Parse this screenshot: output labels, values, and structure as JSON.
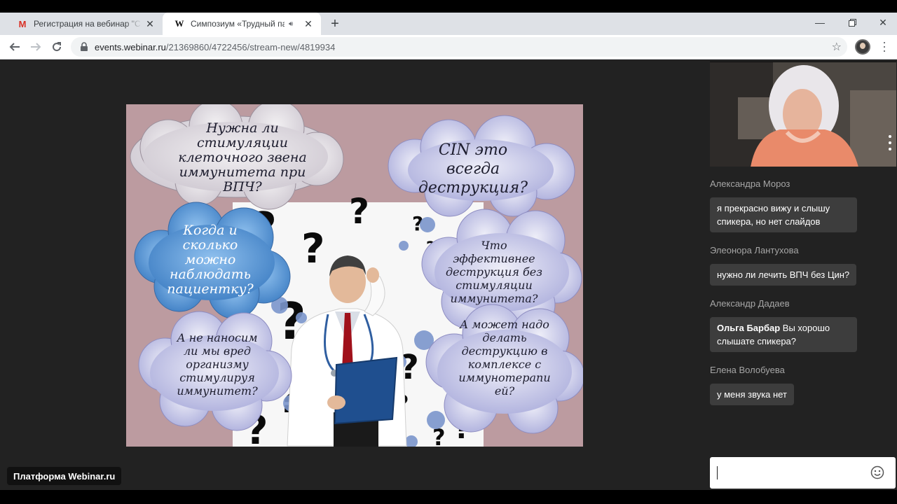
{
  "browser": {
    "tabs": [
      {
        "title": "Регистрация на вебинар \"Симпозиум",
        "favicon": "gmail-icon",
        "active": false
      },
      {
        "title": "Симпозиум «Трудный пациент»",
        "favicon": "webinar-w-icon",
        "active": true
      }
    ],
    "url_host": "events.webinar.ru",
    "url_path": "/21369860/4722456/stream-new/4819934"
  },
  "slide": {
    "clouds": [
      "Нужна ли стимуляции клеточного звена иммунитета при ВПЧ?",
      "CIN это всегда деструкция?",
      "Когда и сколько можно наблюдать пациентку?",
      "Что эффективнее деструкция без стимуляции иммунитета?",
      "А не наносим ли мы вред организму стимулируя иммунитет?",
      "А может надо делать деструкцию в комплексе с иммунотерапией?"
    ],
    "cloud_lines": [
      [
        "Нужна ли",
        "стимуляции",
        "клеточного звена",
        "иммунитета при",
        "ВПЧ?"
      ],
      [
        "CIN это",
        "всегда",
        "деструкция?"
      ],
      [
        "Когда и",
        "сколько",
        "можно",
        "наблюдать",
        "пациентку?"
      ],
      [
        "Что",
        "эффективнее",
        "деструкция без",
        "стимуляции",
        "иммунитета?"
      ],
      [
        "А не наносим",
        "ли мы вред",
        "организму",
        "стимулируя",
        "иммунитет?"
      ],
      [
        "А может надо",
        "делать",
        "деструкцию в",
        "комплексе с",
        "иммунотерапи",
        "ей?"
      ]
    ]
  },
  "platform_label": "Платформа Webinar.ru",
  "chat": {
    "messages": [
      {
        "author": "Александра Мороз",
        "text": "я прекрасно вижу и слышу спикера, но нет слайдов"
      },
      {
        "author": "Элеонора Лантухова",
        "text": "нужно ли лечить ВПЧ без Цин?"
      },
      {
        "author": "Александр Дадаев",
        "mention": "Ольга Барбар",
        "text": "Вы хорошо слышате спикера?"
      },
      {
        "author": "Елена Волобуева",
        "text": "у меня звука нет"
      }
    ],
    "input_placeholder": ""
  },
  "colors": {
    "background": "#222222",
    "bubble": "#3d3d3d",
    "slide_bg": "#bf9ea3",
    "cloud_blue": "#5b9ad6",
    "cloud_lavender": "#c9c6ea"
  }
}
